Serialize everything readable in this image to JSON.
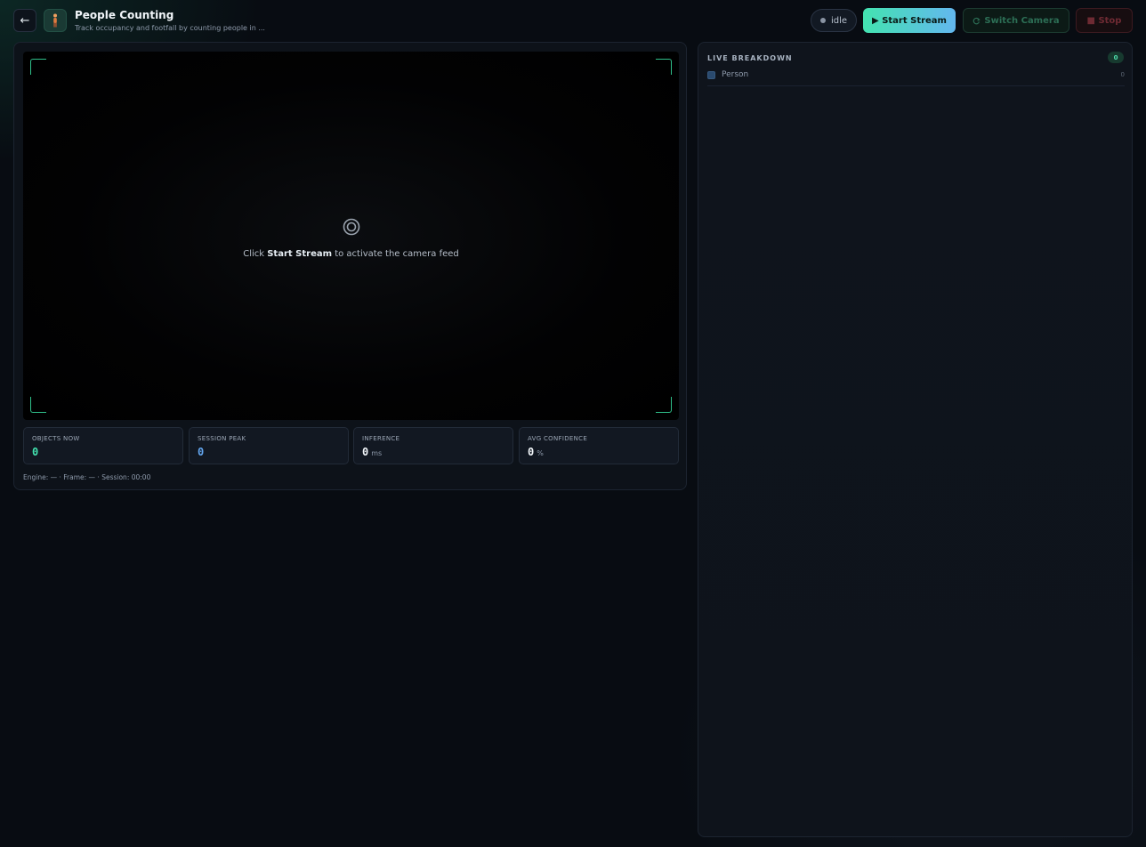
{
  "header": {
    "back_label": "←",
    "title": "People Counting",
    "subtitle": "Track occupancy and footfall by counting people in ...",
    "status": "idle",
    "start_label": "▶ Start Stream",
    "switch_label": "Switch Camera",
    "stop_label": "■ Stop"
  },
  "video": {
    "hint_prefix": "Click ",
    "hint_strong": "Start Stream",
    "hint_suffix": " to activate the camera feed"
  },
  "stats": [
    {
      "label": "OBJECTS NOW",
      "value": "0",
      "unit": "",
      "color": "#43e3b0"
    },
    {
      "label": "SESSION PEAK",
      "value": "0",
      "unit": "",
      "color": "#63a6ef"
    },
    {
      "label": "INFERENCE",
      "value": "0",
      "unit": "ms",
      "color": "#f2f6fa"
    },
    {
      "label": "AVG CONFIDENCE",
      "value": "0",
      "unit": "%",
      "color": "#f2f6fa"
    }
  ],
  "footer": "Engine: — · Frame: — · Session: 00:00",
  "breakdown": {
    "title": "LIVE BREAKDOWN",
    "total": "0",
    "items": [
      {
        "label": "Person",
        "count": "0"
      }
    ]
  },
  "colors": {
    "accent": "#43e3b0",
    "accent_blue": "#63b7ef",
    "stop": "#6e2a33"
  }
}
